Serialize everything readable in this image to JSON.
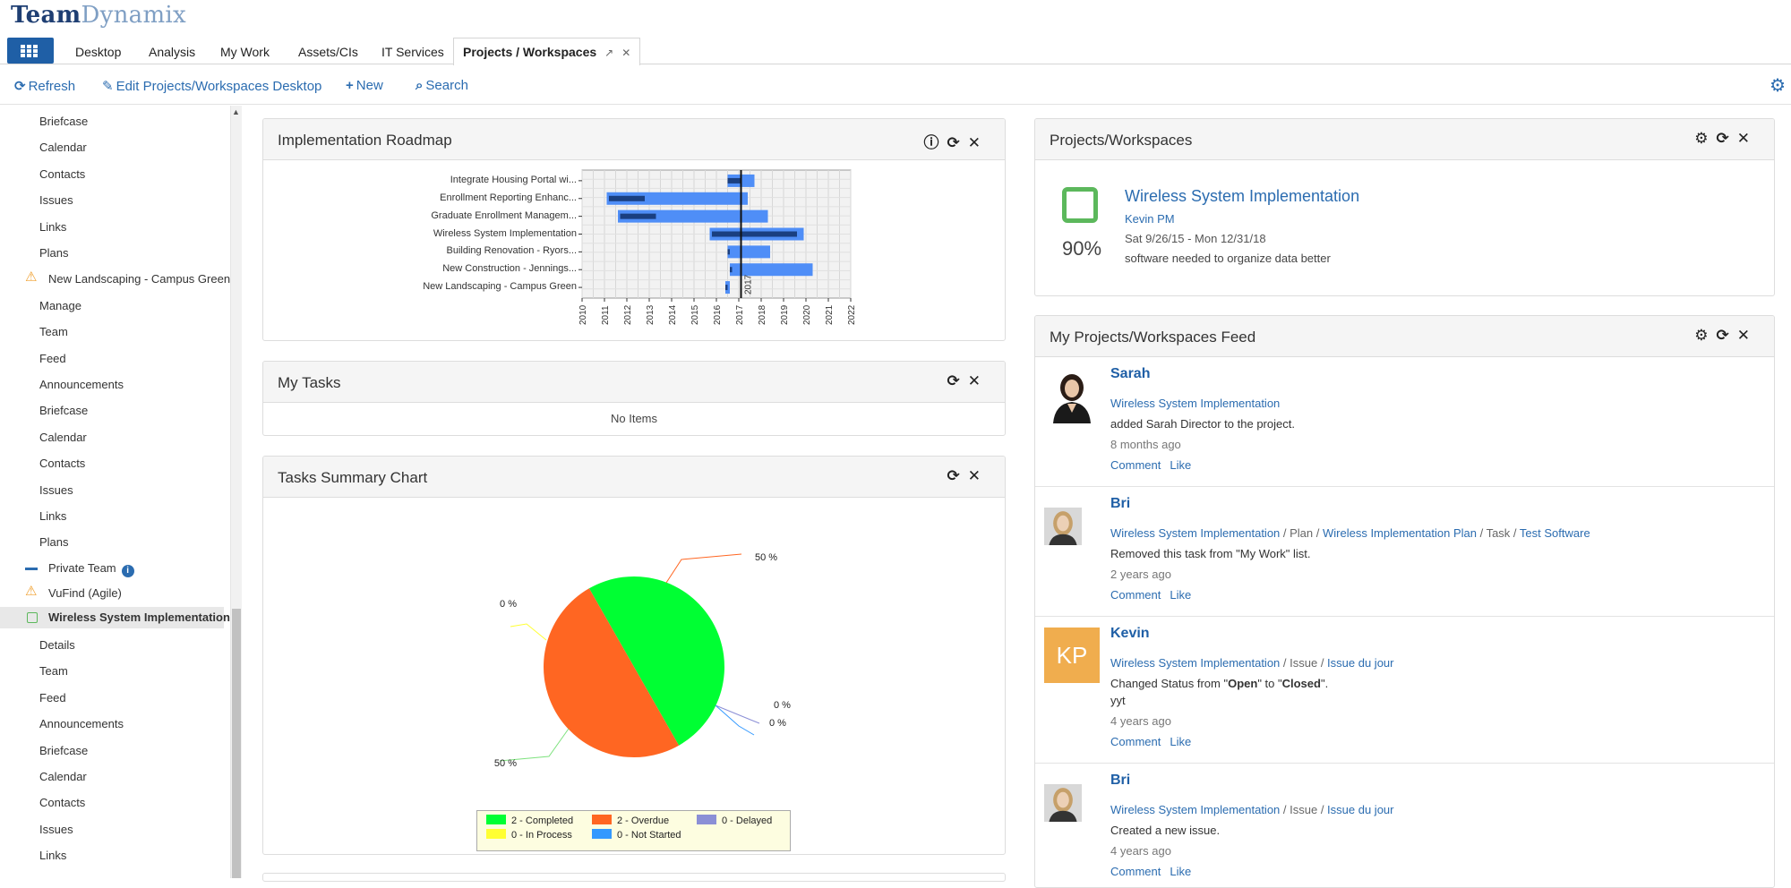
{
  "logo": {
    "part1": "Team",
    "part2": "Dynamix"
  },
  "tabs": [
    "Desktop",
    "Analysis",
    "My Work",
    "Assets/CIs",
    "IT Services"
  ],
  "active_tab": {
    "label": "Projects / Workspaces",
    "pin": "↗",
    "close": "✕"
  },
  "toolbar": {
    "refresh": "Refresh",
    "edit": "Edit Projects/Workspaces Desktop",
    "new": "New",
    "search": "Search"
  },
  "sidebar": {
    "group1": [
      "Briefcase",
      "Calendar",
      "Contacts",
      "Issues",
      "Links",
      "Plans"
    ],
    "project1": "New Landscaping - Campus Green",
    "group2": [
      "Manage",
      "Team",
      "Feed",
      "Announcements",
      "Briefcase",
      "Calendar",
      "Contacts",
      "Issues",
      "Links",
      "Plans"
    ],
    "private_team": "Private Team",
    "vufind": "VuFind (Agile)",
    "selected": "Wireless System Implementation",
    "group3": [
      "Details",
      "Team",
      "Feed",
      "Announcements",
      "Briefcase",
      "Calendar",
      "Contacts",
      "Issues",
      "Links"
    ]
  },
  "roadmap": {
    "title": "Implementation Roadmap",
    "chart_data": {
      "type": "bar",
      "orientation": "horizontal-gantt",
      "categories": [
        "Integrate Housing Portal wi...",
        "Enrollment Reporting Enhanc...",
        "Graduate Enrollment Managem...",
        "Wireless System Implementation",
        "Building Renovation - Ryors...",
        "New Construction - Jennings...",
        "New Landscaping - Campus Green"
      ],
      "planned": [
        [
          2016.5,
          2017.7
        ],
        [
          2011.1,
          2017.4
        ],
        [
          2011.6,
          2018.3
        ],
        [
          2015.7,
          2019.9
        ],
        [
          2016.5,
          2018.4
        ],
        [
          2016.6,
          2020.3
        ],
        [
          2016.4,
          2016.6
        ]
      ],
      "actual": [
        [
          2016.5,
          2017.1
        ],
        [
          2011.2,
          2012.8
        ],
        [
          2011.7,
          2013.3
        ],
        [
          2015.8,
          2019.6
        ],
        [
          2016.5,
          2016.6
        ],
        [
          2016.6,
          2016.7
        ],
        [
          2016.4,
          2016.5
        ]
      ],
      "x_ticks": [
        "2010",
        "2011",
        "2012",
        "2013",
        "2014",
        "2015",
        "2016",
        "2017",
        "2018",
        "2019",
        "2020",
        "2021",
        "2022"
      ],
      "xlim": [
        2010,
        2022
      ],
      "today": 2017.1,
      "today_label": "2017",
      "grid": true,
      "colors": {
        "planned": "#4f8ef7",
        "actual": "#1a3f80"
      }
    }
  },
  "my_tasks": {
    "title": "My Tasks",
    "empty": "No Items"
  },
  "tasks_summary": {
    "title": "Tasks Summary Chart",
    "chart_data": {
      "type": "pie",
      "slices": [
        {
          "name": "2 - Completed",
          "value": 50,
          "label": "50 %",
          "color": "#00ff33"
        },
        {
          "name": "2 - Overdue",
          "value": 50,
          "label": "50 %",
          "color": "#ff6622"
        },
        {
          "name": "0 - Delayed",
          "value": 0,
          "label": "0 %",
          "color": "#8b8fd6"
        },
        {
          "name": "0 - In Process",
          "value": 0,
          "label": "0 %",
          "color": "#ffff33"
        },
        {
          "name": "0 - Not Started",
          "value": 0,
          "label": "0 %",
          "color": "#3399ff"
        }
      ],
      "legend": "bottom",
      "extra_label": "0 %"
    }
  },
  "projects": {
    "title": "Projects/Workspaces",
    "name": "Wireless System Implementation",
    "pm": "Kevin PM",
    "dates": "Sat 9/26/15 - Mon 12/31/18",
    "desc": "software needed to organize data better",
    "percent": "90%"
  },
  "feed": {
    "title": "My Projects/Workspaces Feed",
    "comment": "Comment",
    "like": "Like",
    "items": [
      {
        "name": "Sarah",
        "link": "Wireless System Implementation",
        "text": "added Sarah Director to the project.",
        "time": "8 months ago"
      },
      {
        "name": "Bri",
        "path": [
          "Wireless System Implementation",
          "Plan",
          "Wireless Implementation Plan",
          "Task",
          "Test Software"
        ],
        "text": "Removed this task from \"My Work\" list.",
        "time": "2 years ago"
      },
      {
        "name": "Kevin",
        "initials": "KP",
        "avatar_color": "#f0ad4e",
        "path": [
          "Wireless System Implementation",
          "Issue",
          "Issue du jour"
        ],
        "text_pre": "Changed Status from \"",
        "from": "Open",
        "text_mid": "\" to \"",
        "to": "Closed",
        "text_post": "\".",
        "extra": "yyt",
        "time": "4 years ago"
      },
      {
        "name": "Bri",
        "path": [
          "Wireless System Implementation",
          "Issue",
          "Issue du jour"
        ],
        "text": "Created a new issue.",
        "time": "4 years ago"
      }
    ]
  }
}
